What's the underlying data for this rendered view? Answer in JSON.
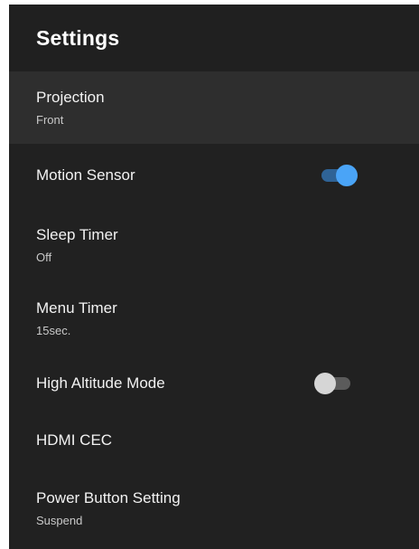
{
  "header": {
    "title": "Settings"
  },
  "items": [
    {
      "title": "Projection",
      "subtitle": "Front"
    },
    {
      "title": "Motion Sensor",
      "toggle": "on"
    },
    {
      "title": "Sleep Timer",
      "subtitle": "Off"
    },
    {
      "title": "Menu Timer",
      "subtitle": "15sec."
    },
    {
      "title": "High Altitude Mode",
      "toggle": "off"
    },
    {
      "title": "HDMI CEC"
    },
    {
      "title": "Power Button Setting",
      "subtitle": "Suspend"
    }
  ],
  "colors": {
    "background": "#212121",
    "selected_row": "#2e2e2e",
    "toggle_on_knob": "#4aa4f7",
    "toggle_on_track": "#2f6396",
    "toggle_off_knob": "#d6d6d6",
    "toggle_off_track": "#5b5b5b"
  }
}
